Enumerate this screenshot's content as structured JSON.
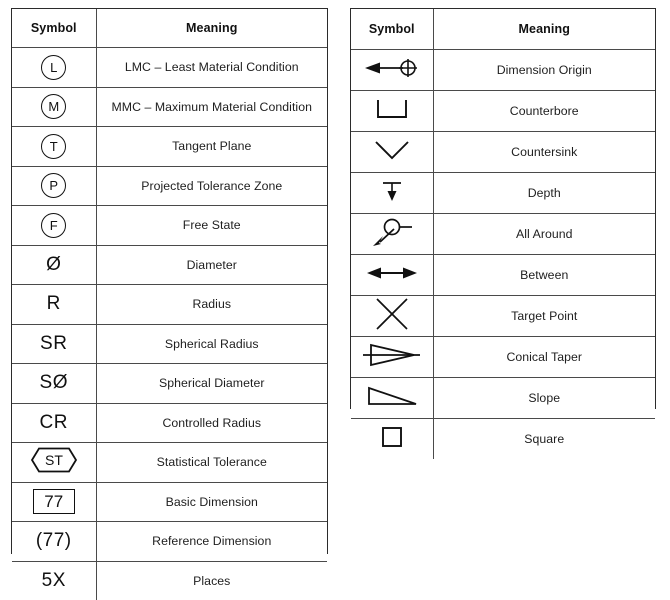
{
  "document": {
    "title": "GD&T Symbols Reference Tables",
    "background_color": "#ffffff",
    "border_color": "#2b2b2b",
    "text_color": "#1a1a1a"
  },
  "tables": [
    {
      "id": "left-table",
      "name": "material-condition-and-dimension-symbols",
      "columns": [
        "Symbol",
        "Meaning"
      ],
      "rows": [
        {
          "symbol_kind": "circled-letter",
          "symbol_text": "L",
          "meaning": "LMC – Least Material Condition"
        },
        {
          "symbol_kind": "circled-letter",
          "symbol_text": "M",
          "meaning": "MMC – Maximum Material Condition"
        },
        {
          "symbol_kind": "circled-letter",
          "symbol_text": "T",
          "meaning": "Tangent Plane"
        },
        {
          "symbol_kind": "circled-letter",
          "symbol_text": "P",
          "meaning": "Projected Tolerance Zone"
        },
        {
          "symbol_kind": "circled-letter",
          "symbol_text": "F",
          "meaning": "Free State"
        },
        {
          "symbol_kind": "text",
          "symbol_text": "Ø",
          "meaning": "Diameter"
        },
        {
          "symbol_kind": "text",
          "symbol_text": "R",
          "meaning": "Radius"
        },
        {
          "symbol_kind": "text",
          "symbol_text": "SR",
          "meaning": "Spherical Radius"
        },
        {
          "symbol_kind": "text",
          "symbol_text": "SØ",
          "meaning": "Spherical Diameter"
        },
        {
          "symbol_kind": "text",
          "symbol_text": "CR",
          "meaning": "Controlled Radius"
        },
        {
          "symbol_kind": "hexagon-text",
          "symbol_text": "ST",
          "meaning": "Statistical Tolerance"
        },
        {
          "symbol_kind": "boxed-text",
          "symbol_text": "77",
          "meaning": "Basic Dimension"
        },
        {
          "symbol_kind": "text",
          "symbol_text": "(77)",
          "meaning": "Reference Dimension"
        },
        {
          "symbol_kind": "text",
          "symbol_text": "5X",
          "meaning": "Places"
        }
      ]
    },
    {
      "id": "right-table",
      "name": "feature-and-annotation-symbols",
      "columns": [
        "Symbol",
        "Meaning"
      ],
      "rows": [
        {
          "symbol_kind": "svg",
          "symbol_icon": "dimension-origin-icon",
          "meaning": "Dimension Origin"
        },
        {
          "symbol_kind": "svg",
          "symbol_icon": "counterbore-icon",
          "meaning": "Counterbore"
        },
        {
          "symbol_kind": "svg",
          "symbol_icon": "countersink-icon",
          "meaning": "Countersink"
        },
        {
          "symbol_kind": "svg",
          "symbol_icon": "depth-icon",
          "meaning": "Depth"
        },
        {
          "symbol_kind": "svg",
          "symbol_icon": "all-around-icon",
          "meaning": "All Around"
        },
        {
          "symbol_kind": "svg",
          "symbol_icon": "between-icon",
          "meaning": "Between"
        },
        {
          "symbol_kind": "svg",
          "symbol_icon": "target-point-icon",
          "meaning": "Target Point"
        },
        {
          "symbol_kind": "svg",
          "symbol_icon": "conical-taper-icon",
          "meaning": "Conical Taper"
        },
        {
          "symbol_kind": "svg",
          "symbol_icon": "slope-icon",
          "meaning": "Slope"
        },
        {
          "symbol_kind": "svg",
          "symbol_icon": "square-icon",
          "meaning": "Square"
        }
      ]
    }
  ]
}
